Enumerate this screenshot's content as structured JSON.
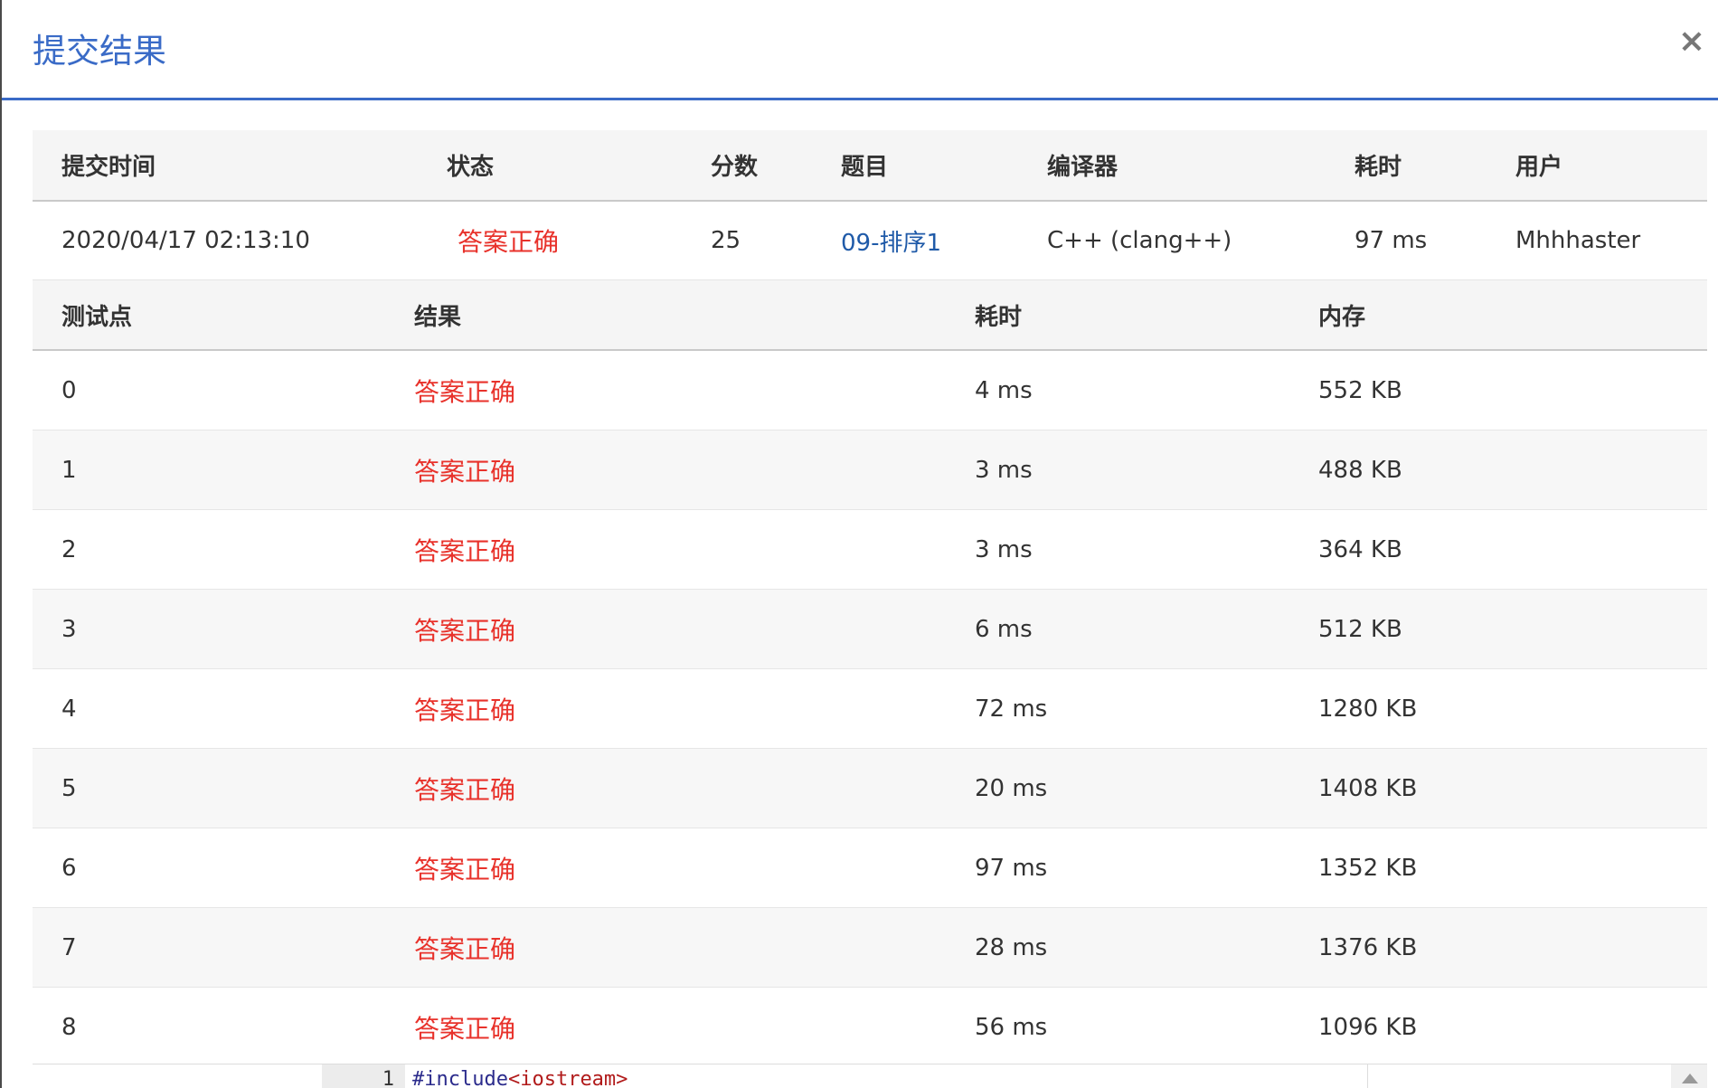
{
  "dialog": {
    "title": "提交结果",
    "close": "×"
  },
  "summary": {
    "headers": [
      "提交时间",
      "状态",
      "分数",
      "题目",
      "编译器",
      "耗时",
      "用户"
    ],
    "row": {
      "time": "2020/04/17 02:13:10",
      "status": "答案正确",
      "score": "25",
      "problem": "09-排序1",
      "compiler": "C++ (clang++)",
      "elapsed": "97 ms",
      "user": "Mhhhaster"
    }
  },
  "tests": {
    "headers": [
      "测试点",
      "结果",
      "耗时",
      "内存"
    ],
    "rows": [
      {
        "id": "0",
        "result": "答案正确",
        "time": "4 ms",
        "memory": "552 KB"
      },
      {
        "id": "1",
        "result": "答案正确",
        "time": "3 ms",
        "memory": "488 KB"
      },
      {
        "id": "2",
        "result": "答案正确",
        "time": "3 ms",
        "memory": "364 KB"
      },
      {
        "id": "3",
        "result": "答案正确",
        "time": "6 ms",
        "memory": "512 KB"
      },
      {
        "id": "4",
        "result": "答案正确",
        "time": "72 ms",
        "memory": "1280 KB"
      },
      {
        "id": "5",
        "result": "答案正确",
        "time": "20 ms",
        "memory": "1408 KB"
      },
      {
        "id": "6",
        "result": "答案正确",
        "time": "97 ms",
        "memory": "1352 KB"
      },
      {
        "id": "7",
        "result": "答案正确",
        "time": "28 ms",
        "memory": "1376 KB"
      },
      {
        "id": "8",
        "result": "答案正确",
        "time": "56 ms",
        "memory": "1096 KB"
      }
    ]
  },
  "code": {
    "line_number": "1",
    "directive": "#include",
    "header": "<iostream>"
  },
  "colors": {
    "accent": "#3a6bc7",
    "success": "#e8322b",
    "link": "#1f5aa8"
  }
}
